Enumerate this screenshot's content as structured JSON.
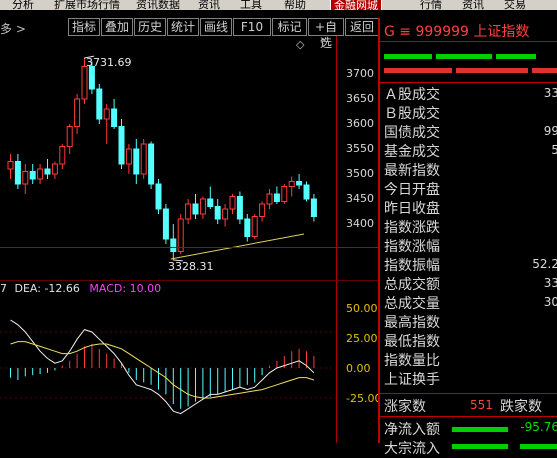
{
  "menu": {
    "items": [
      "分析",
      "扩展市场行情",
      "资讯数据",
      "资讯",
      "工具",
      "帮助"
    ],
    "brand": "金融网城",
    "right_items": [
      "行情",
      "资讯",
      "交易"
    ]
  },
  "toolbar": {
    "left_label": "多 >",
    "buttons": [
      "指标",
      "叠加",
      "历史",
      "统计",
      "画线",
      "F10",
      "标记",
      "+自选",
      "返回"
    ]
  },
  "chart": {
    "price_ticks": [
      "3700",
      "3650",
      "3600",
      "3550",
      "3500",
      "3450",
      "3400"
    ],
    "high_label": "3731.69",
    "low_label": "3328.31",
    "macd_header": {
      "prefix": "7",
      "dea": "DEA: -12.66",
      "macd": "MACD: 10.00"
    },
    "macd_ticks": [
      "50.00",
      "25.00",
      "0.00",
      "-25.00"
    ],
    "up_color": "#ff3a3a",
    "down_color": "#54ffff"
  },
  "chart_data": {
    "type": "candlestick",
    "ylim": [
      3300,
      3750
    ],
    "candles": [
      {
        "o": 3510,
        "h": 3540,
        "l": 3490,
        "c": 3525
      },
      {
        "o": 3525,
        "h": 3540,
        "l": 3470,
        "c": 3480
      },
      {
        "o": 3480,
        "h": 3520,
        "l": 3460,
        "c": 3505
      },
      {
        "o": 3505,
        "h": 3520,
        "l": 3480,
        "c": 3490
      },
      {
        "o": 3490,
        "h": 3520,
        "l": 3480,
        "c": 3510
      },
      {
        "o": 3510,
        "h": 3530,
        "l": 3490,
        "c": 3500
      },
      {
        "o": 3500,
        "h": 3525,
        "l": 3490,
        "c": 3520
      },
      {
        "o": 3520,
        "h": 3560,
        "l": 3510,
        "c": 3555
      },
      {
        "o": 3555,
        "h": 3600,
        "l": 3540,
        "c": 3595
      },
      {
        "o": 3595,
        "h": 3660,
        "l": 3580,
        "c": 3650
      },
      {
        "o": 3650,
        "h": 3731.69,
        "l": 3640,
        "c": 3715
      },
      {
        "o": 3715,
        "h": 3725,
        "l": 3660,
        "c": 3670
      },
      {
        "o": 3670,
        "h": 3680,
        "l": 3600,
        "c": 3610
      },
      {
        "o": 3610,
        "h": 3640,
        "l": 3560,
        "c": 3630
      },
      {
        "o": 3630,
        "h": 3650,
        "l": 3590,
        "c": 3595
      },
      {
        "o": 3595,
        "h": 3610,
        "l": 3510,
        "c": 3520
      },
      {
        "o": 3520,
        "h": 3560,
        "l": 3500,
        "c": 3550
      },
      {
        "o": 3550,
        "h": 3570,
        "l": 3480,
        "c": 3500
      },
      {
        "o": 3500,
        "h": 3570,
        "l": 3490,
        "c": 3560
      },
      {
        "o": 3560,
        "h": 3565,
        "l": 3470,
        "c": 3480
      },
      {
        "o": 3480,
        "h": 3490,
        "l": 3420,
        "c": 3430
      },
      {
        "o": 3430,
        "h": 3440,
        "l": 3360,
        "c": 3370
      },
      {
        "o": 3370,
        "h": 3400,
        "l": 3328.31,
        "c": 3345
      },
      {
        "o": 3345,
        "h": 3420,
        "l": 3340,
        "c": 3410
      },
      {
        "o": 3410,
        "h": 3450,
        "l": 3400,
        "c": 3440
      },
      {
        "o": 3440,
        "h": 3460,
        "l": 3410,
        "c": 3420
      },
      {
        "o": 3420,
        "h": 3455,
        "l": 3410,
        "c": 3450
      },
      {
        "o": 3450,
        "h": 3475,
        "l": 3430,
        "c": 3435
      },
      {
        "o": 3435,
        "h": 3450,
        "l": 3400,
        "c": 3410
      },
      {
        "o": 3410,
        "h": 3440,
        "l": 3395,
        "c": 3430
      },
      {
        "o": 3430,
        "h": 3460,
        "l": 3420,
        "c": 3455
      },
      {
        "o": 3455,
        "h": 3465,
        "l": 3400,
        "c": 3410
      },
      {
        "o": 3410,
        "h": 3420,
        "l": 3365,
        "c": 3375
      },
      {
        "o": 3375,
        "h": 3420,
        "l": 3370,
        "c": 3415
      },
      {
        "o": 3415,
        "h": 3445,
        "l": 3405,
        "c": 3440
      },
      {
        "o": 3440,
        "h": 3470,
        "l": 3430,
        "c": 3460
      },
      {
        "o": 3460,
        "h": 3475,
        "l": 3440,
        "c": 3445
      },
      {
        "o": 3445,
        "h": 3480,
        "l": 3440,
        "c": 3475
      },
      {
        "o": 3475,
        "h": 3495,
        "l": 3455,
        "c": 3485
      },
      {
        "o": 3485,
        "h": 3500,
        "l": 3470,
        "c": 3478
      },
      {
        "o": 3478,
        "h": 3485,
        "l": 3445,
        "c": 3450
      },
      {
        "o": 3450,
        "h": 3460,
        "l": 3405,
        "c": 3415
      }
    ],
    "macd_ylim": [
      -40,
      65
    ],
    "macd_hist": [
      -8,
      -10,
      -7,
      -6,
      -5,
      -4,
      -2,
      2,
      6,
      12,
      18,
      20,
      16,
      12,
      8,
      4,
      -4,
      -10,
      -12,
      -14,
      -18,
      -22,
      -30,
      -34,
      -32,
      -28,
      -26,
      -24,
      -22,
      -20,
      -18,
      -16,
      -14,
      -12,
      -6,
      2,
      6,
      10,
      14,
      16,
      14,
      10
    ],
    "dif": [
      40,
      36,
      30,
      22,
      14,
      8,
      4,
      6,
      14,
      24,
      32,
      30,
      24,
      18,
      12,
      4,
      -6,
      -14,
      -16,
      -18,
      -22,
      -28,
      -36,
      -38,
      -34,
      -30,
      -26,
      -22,
      -22,
      -20,
      -18,
      -16,
      -18,
      -16,
      -10,
      -4,
      0,
      2,
      4,
      6,
      2,
      -4
    ],
    "dea": [
      20,
      22,
      22,
      20,
      18,
      16,
      14,
      12,
      12,
      14,
      17,
      19,
      20,
      20,
      18,
      16,
      12,
      8,
      4,
      0,
      -4,
      -8,
      -14,
      -18,
      -22,
      -24,
      -25,
      -25,
      -24,
      -23,
      -22,
      -21,
      -20,
      -19,
      -18,
      -16,
      -14,
      -12,
      -10,
      -8,
      -8,
      -10
    ]
  },
  "rpanel": {
    "title": "G ≡ 999999 上证指数",
    "rows": [
      {
        "label": "Ａ股成交",
        "value": "33"
      },
      {
        "label": "Ｂ股成交",
        "value": ""
      },
      {
        "label": "国债成交",
        "value": "99"
      },
      {
        "label": "基金成交",
        "value": "5"
      },
      {
        "label": "最新指数",
        "value": ""
      },
      {
        "label": "今日开盘",
        "value": ""
      },
      {
        "label": "昨日收盘",
        "value": ""
      },
      {
        "label": "指数涨跌",
        "value": ""
      },
      {
        "label": "指数涨幅",
        "value": ""
      },
      {
        "label": "指数振幅",
        "value": "52.2"
      },
      {
        "label": "总成交额",
        "value": "33"
      },
      {
        "label": "总成交量",
        "value": "30"
      },
      {
        "label": "最高指数",
        "value": ""
      },
      {
        "label": "最低指数",
        "value": ""
      },
      {
        "label": "指数量比",
        "value": ""
      },
      {
        "label": "上证换手",
        "value": ""
      }
    ],
    "up_label": "涨家数",
    "up_count": "551",
    "down_label": "跌家数",
    "net_inflow_label": "净流入额",
    "net_inflow_value": "-95.76",
    "bottom_cut_label": "大宗流入"
  }
}
